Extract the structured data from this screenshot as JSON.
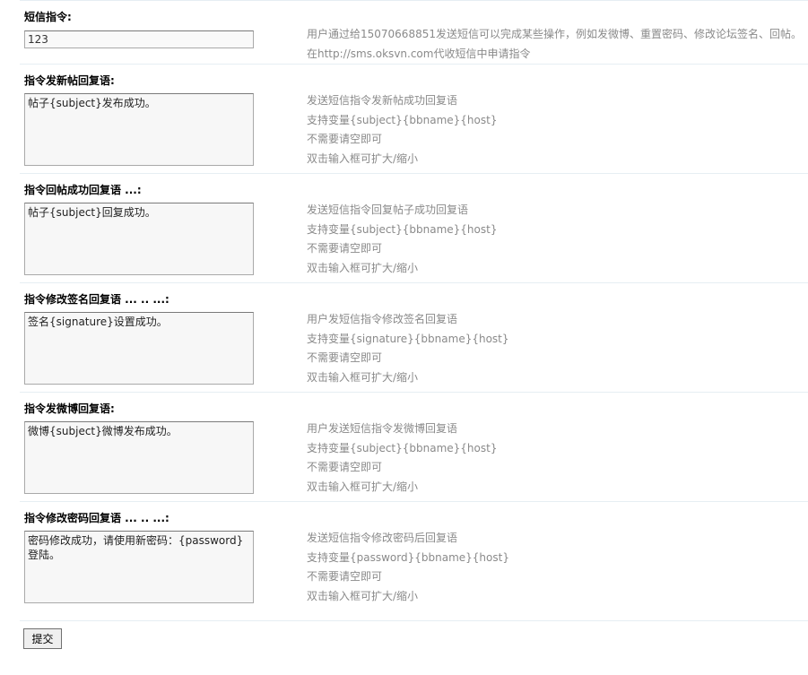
{
  "sms_command": {
    "label": "短信指令:",
    "value": "123",
    "tips": [
      "用户通过给15070668851发送短信可以完成某些操作，例如发微博、重置密码、修改论坛签名、回帖。",
      "在http://sms.oksvn.com代收短信中申请指令"
    ]
  },
  "sections": [
    {
      "label": "指令发新帖回复语:",
      "value": "帖子{subject}发布成功。",
      "tips": [
        "发送短信指令发新帖成功回复语",
        "支持变量{subject}{bbname}{host}",
        "不需要请空即可",
        "双击输入框可扩大/缩小"
      ]
    },
    {
      "label": "指令回帖成功回复语 ...:",
      "value": "帖子{subject}回复成功。",
      "tips": [
        "发送短信指令回复帖子成功回复语",
        "支持变量{subject}{bbname}{host}",
        "不需要请空即可",
        "双击输入框可扩大/缩小"
      ]
    },
    {
      "label": "指令修改签名回复语 ... .. ...:",
      "value": "签名{signature}设置成功。",
      "tips": [
        "用户发短信指令修改签名回复语",
        "支持变量{signature}{bbname}{host}",
        "不需要请空即可",
        "双击输入框可扩大/缩小"
      ]
    },
    {
      "label": "指令发微博回复语:",
      "value": "微博{subject}微博发布成功。",
      "tips": [
        "用户发送短信指令发微博回复语",
        "支持变量{subject}{bbname}{host}",
        "不需要请空即可",
        "双击输入框可扩大/缩小"
      ]
    },
    {
      "label": "指令修改密码回复语 ... .. ...:",
      "value": "密码修改成功，请使用新密码：{password}登陆。",
      "tips": [
        "发送短信指令修改密码后回复语",
        "支持变量{password}{bbname}{host}",
        "不需要请空即可",
        "双击输入框可扩大/缩小"
      ]
    }
  ],
  "submit_label": "提交"
}
